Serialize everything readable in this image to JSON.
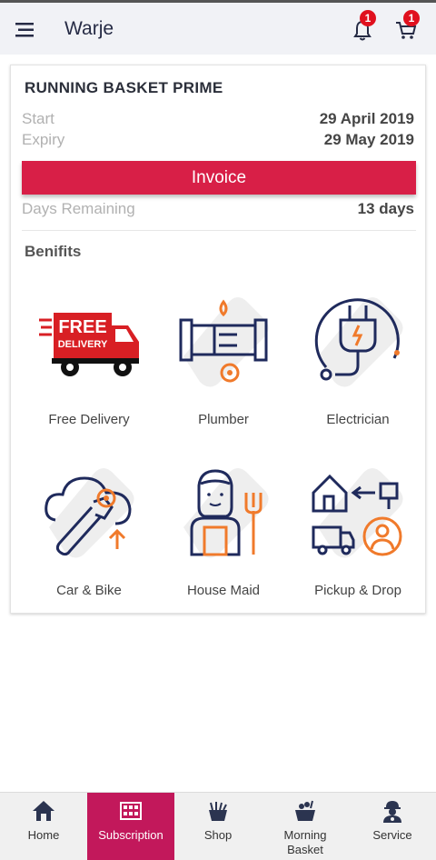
{
  "header": {
    "title": "Warje",
    "notifications_count": "1",
    "cart_count": "1"
  },
  "plan": {
    "title": "RUNNING BASKET PRIME",
    "start_label": "Start",
    "start_value": "29 April 2019",
    "expiry_label": "Expiry",
    "expiry_value": "29 May 2019",
    "invoice_label": "Invoice",
    "days_label": "Days Remaining",
    "days_value": "13 days"
  },
  "benefits": {
    "title": "Benifits",
    "items": [
      {
        "label": "Free Delivery",
        "icon": "free-delivery-truck-icon",
        "icon_text": "FREE DELIVERY"
      },
      {
        "label": "Plumber",
        "icon": "pipe-icon"
      },
      {
        "label": "Electrician",
        "icon": "plug-icon"
      },
      {
        "label": "Car & Bike",
        "icon": "wrench-gear-icon"
      },
      {
        "label": "House Maid",
        "icon": "maid-icon"
      },
      {
        "label": "Pickup & Drop",
        "icon": "pickup-drop-icon"
      }
    ]
  },
  "bottom_nav": {
    "items": [
      {
        "label": "Home",
        "icon": "home-icon"
      },
      {
        "label": "Subscription",
        "icon": "subscription-icon",
        "active": true
      },
      {
        "label": "Shop",
        "icon": "shop-icon"
      },
      {
        "label": "Morning Basket",
        "icon": "basket-icon"
      },
      {
        "label": "Service",
        "icon": "service-worker-icon"
      }
    ]
  },
  "colors": {
    "accent": "#d81f47",
    "nav_active": "#c2185b",
    "icon_navy": "#1f2a5c",
    "icon_orange": "#f07a2b",
    "badge": "#e0101e"
  }
}
